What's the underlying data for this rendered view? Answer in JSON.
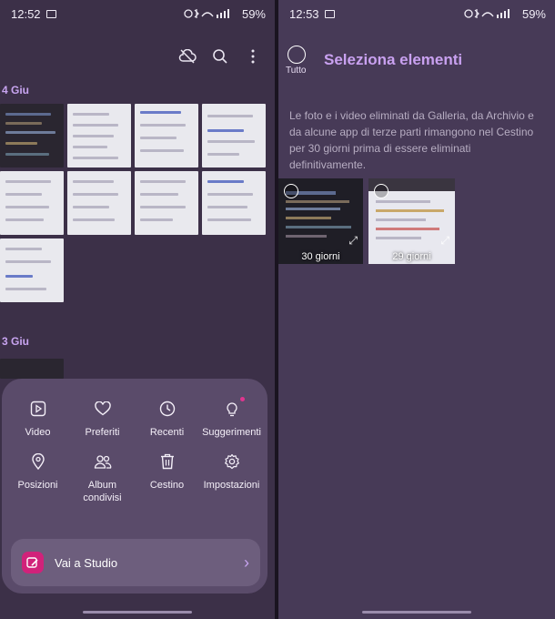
{
  "left": {
    "status": {
      "time": "12:52",
      "battery": "59%",
      "net": "VoLTE"
    },
    "sections": [
      {
        "date": "4 Giu"
      },
      {
        "date": "3 Giu"
      }
    ],
    "menu": [
      {
        "label": "Video",
        "icon": "play-icon"
      },
      {
        "label": "Preferiti",
        "icon": "heart-icon"
      },
      {
        "label": "Recenti",
        "icon": "clock-icon"
      },
      {
        "label": "Suggerimenti",
        "icon": "lightbulb-icon"
      },
      {
        "label": "Posizioni",
        "icon": "location-pin-icon"
      },
      {
        "label": "Album condivisi",
        "icon": "people-icon"
      },
      {
        "label": "Cestino",
        "icon": "trash-icon"
      },
      {
        "label": "Impostazioni",
        "icon": "gear-icon"
      }
    ],
    "studio": {
      "label": "Vai a Studio"
    }
  },
  "right": {
    "status": {
      "time": "12:53",
      "battery": "59%"
    },
    "select_all": "Tutto",
    "title": "Seleziona elementi",
    "info": "Le foto e i video eliminati da Galleria, da Archivio e da alcune app di terze parti rimangono nel Cestino per 30 giorni prima di essere eliminati definitivamente.",
    "items": [
      {
        "days": "30 giorni"
      },
      {
        "days": "29 giorni"
      }
    ]
  },
  "colors": {
    "accent": "#c9a1f0",
    "studio": "#d1227a",
    "sheet": "#5a4b6a"
  }
}
